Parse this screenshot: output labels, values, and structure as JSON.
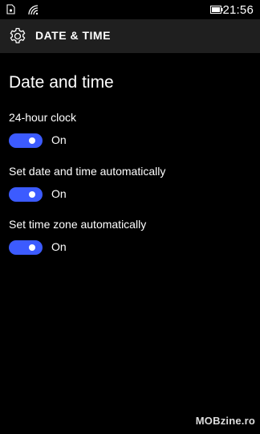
{
  "status_bar": {
    "time": "21:56",
    "icons": [
      "notification-icon",
      "wifi-icon",
      "battery-icon"
    ]
  },
  "header": {
    "icon": "gear-icon",
    "title": "DATE & TIME"
  },
  "page": {
    "title": "Date and time"
  },
  "settings": [
    {
      "label": "24-hour clock",
      "state": "On",
      "enabled": true
    },
    {
      "label": "Set date and time automatically",
      "state": "On",
      "enabled": true
    },
    {
      "label": "Set time zone automatically",
      "state": "On",
      "enabled": true
    }
  ],
  "watermark": "MOBzine.ro",
  "colors": {
    "accent": "#3c5bff",
    "header_bg": "#1f1f1f",
    "background": "#000000"
  }
}
